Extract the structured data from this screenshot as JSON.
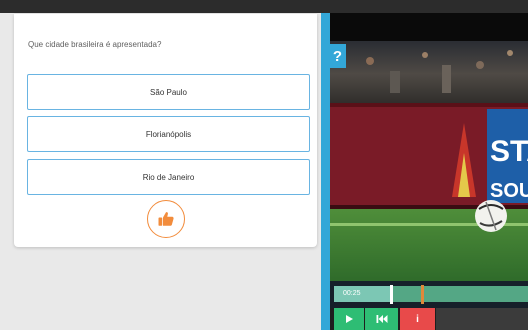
{
  "quiz": {
    "question": "Que cidade brasileira é apresentada?",
    "answers": [
      "São Paulo",
      "Florianópolis",
      "Rio de Janeiro"
    ]
  },
  "help": {
    "label": "?"
  },
  "video": {
    "current_time": "00:25",
    "progress": 0.29,
    "marker_position": 0.45,
    "ad_board_text": "STA",
    "ad_board_text_2": "SOUT"
  },
  "controls": {
    "info_label": "i"
  },
  "icons": {
    "like": "thumbs-up-icon",
    "play": "play-icon",
    "rewind": "skip-back-icon",
    "help": "help-icon",
    "info": "info-icon"
  },
  "colors": {
    "accent_blue": "#33a7d8",
    "answer_border": "#69b4e2",
    "like_orange": "#f28c3c",
    "control_green": "#2ebd74",
    "control_red": "#e84a4a"
  }
}
